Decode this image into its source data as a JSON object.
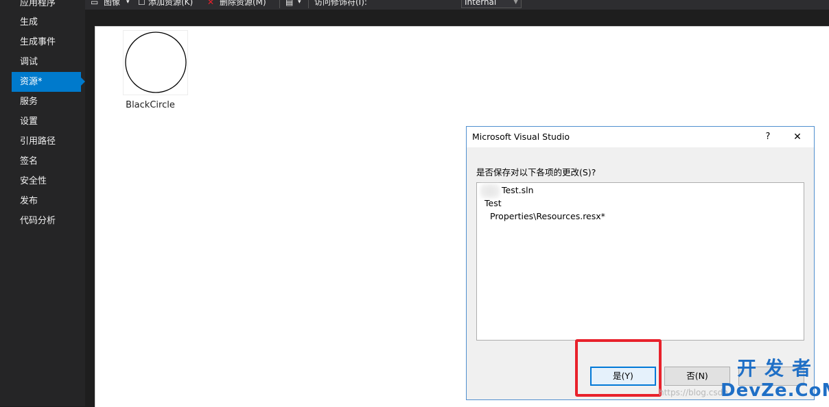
{
  "sidebar": {
    "items": [
      {
        "label": "应用程序"
      },
      {
        "label": "生成"
      },
      {
        "label": "生成事件"
      },
      {
        "label": "调试"
      },
      {
        "label": "资源*",
        "active": true
      },
      {
        "label": "服务"
      },
      {
        "label": "设置"
      },
      {
        "label": "引用路径"
      },
      {
        "label": "签名"
      },
      {
        "label": "安全性"
      },
      {
        "label": "发布"
      },
      {
        "label": "代码分析"
      }
    ]
  },
  "toolbar": {
    "images_label": "图像",
    "add_resource_label": "添加资源(K)",
    "remove_resource_label": "删除资源(M)",
    "access_modifier_label": "访问修饰符(I):",
    "access_modifier_value": "Internal"
  },
  "resources": [
    {
      "name": "BlackCircle",
      "icon": "circle-image"
    }
  ],
  "dialog": {
    "title": "Microsoft Visual Studio",
    "help": "?",
    "close": "✕",
    "question": "是否保存对以下各项的更改(S)?",
    "items": [
      {
        "text": "Test.sln",
        "level": 0
      },
      {
        "text": "Test",
        "level": 0
      },
      {
        "text": "Properties\\Resources.resx*",
        "level": 1
      }
    ],
    "buttons": {
      "yes": "是(Y)",
      "no": "否(N)"
    }
  },
  "watermark": {
    "url": "https://blog.csdn",
    "brand_cn": "开发者",
    "brand_en": "DevZe.CoM"
  },
  "colors": {
    "accent": "#007acc",
    "highlight": "#e8212b",
    "watermark": "#1f6fc6"
  }
}
